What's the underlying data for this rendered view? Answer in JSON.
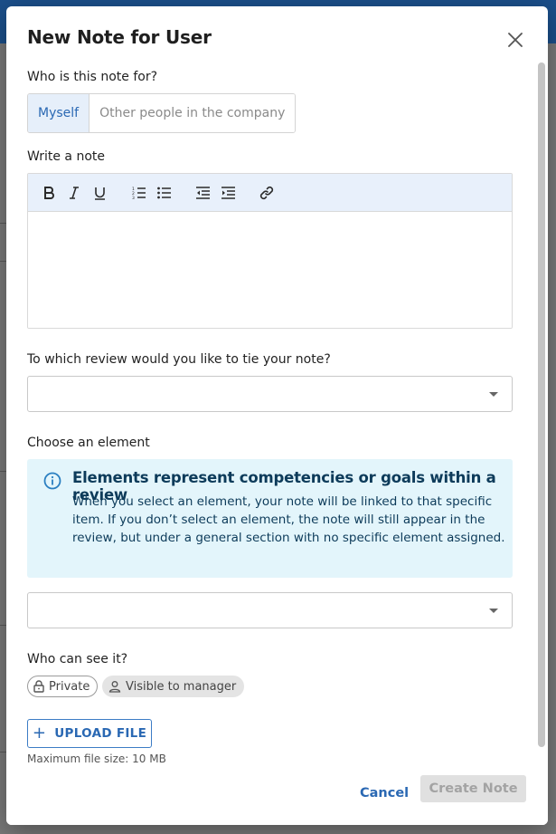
{
  "dialog": {
    "title": "New Note for User"
  },
  "recipient": {
    "label": "Who is this note for?",
    "options": [
      "Myself",
      "Other people in the company"
    ],
    "selected": "Myself"
  },
  "note": {
    "label": "Write a note",
    "toolbar_icons": [
      "bold-icon",
      "italic-icon",
      "underline-icon",
      "ordered-list-icon",
      "bullet-list-icon",
      "outdent-icon",
      "indent-icon",
      "link-icon"
    ],
    "value": ""
  },
  "review": {
    "label": "To which review would you like to tie your note?",
    "value": ""
  },
  "element": {
    "label": "Choose an element",
    "info_title": "Elements represent competencies or goals within a review",
    "info_text": "When you select an element, your note will be linked to that specific item. If you don’t select an element, the note will still appear in the review, but under a general section with no specific element assigned.",
    "value": ""
  },
  "visibility": {
    "label": "Who can see it?",
    "private_label": "Private",
    "manager_label": "Visible to manager"
  },
  "upload": {
    "button_label": "UPLOAD FILE",
    "max_size": "Maximum file size: 10 MB"
  },
  "footer": {
    "cancel_label": "Cancel",
    "create_label": "Create Note"
  },
  "colors": {
    "accent": "#2a68b3",
    "info_bg": "#e3f5fb",
    "toolbar_bg": "#e8f0fb"
  }
}
